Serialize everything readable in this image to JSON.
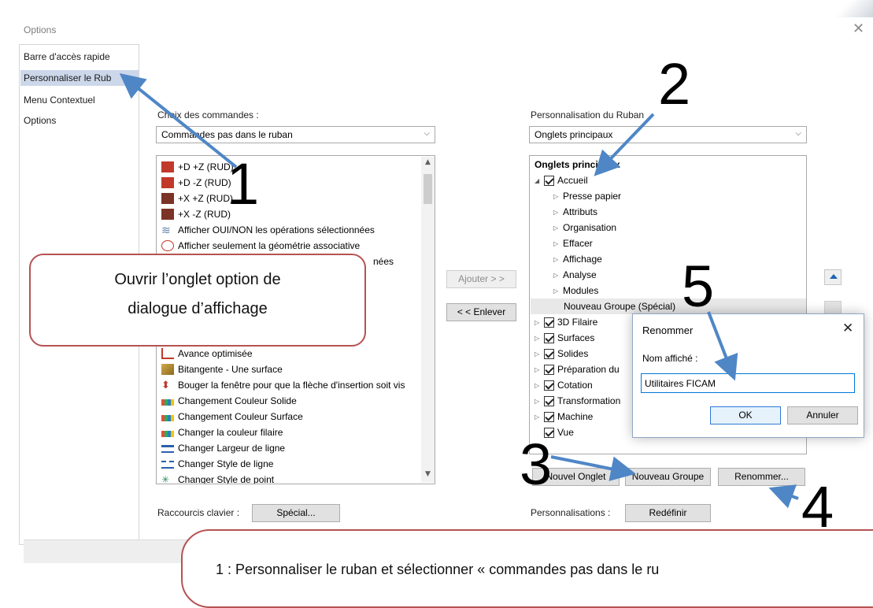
{
  "window": {
    "title": "Options",
    "close_glyph": "✕"
  },
  "nav": {
    "items": [
      "Barre d'accès rapide",
      "Personnaliser le Rub",
      "Menu Contextuel",
      "Options"
    ]
  },
  "left": {
    "label": "Choix des commandes :",
    "combo_value": "Commandes pas dans le ruban",
    "commands": [
      "+D +Z (RUD)",
      "+D -Z (RUD)",
      "+X +Z (RUD)",
      "+X -Z (RUD)",
      "Afficher OUI/NON les opérations sélectionnées",
      "Afficher seulement la géométrie associative",
      "nées",
      "Avance optimisée",
      "Bitangente - Une surface",
      "Bouger la fenêtre pour que la flèche d'insertion soit vis",
      "Changement Couleur Solide",
      "Changement Couleur Surface",
      "Changer la couleur filaire",
      "Changer Largeur de ligne",
      "Changer Style de ligne",
      "Changer Style de point"
    ],
    "shortcuts_label": "Raccourcis clavier :",
    "special_button": "Spécial..."
  },
  "middle": {
    "add_button": "Ajouter > >",
    "remove_button": "< < Enlever"
  },
  "right": {
    "label": "Personnalisation du Ruban",
    "combo_value": "Onglets principaux",
    "tree_header": "Onglets principaux",
    "tree_top": "Accueil",
    "tree_children": [
      "Presse papier",
      "Attributs",
      "Organisation",
      "Effacer",
      "Affichage",
      "Analyse",
      "Modules"
    ],
    "new_group_special": "Nouveau Groupe (Spécial)",
    "tabs": [
      "3D Filaire",
      "Surfaces",
      "Solides",
      "Préparation du",
      "Cotation",
      "Transformation",
      "Machine",
      "Vue"
    ],
    "new_tab_button": "Nouvel Onglet",
    "new_group_button": "Nouveau Groupe",
    "rename_button": "Renommer...",
    "customizations_label": "Personnalisations :",
    "reset_button": "Redéfinir"
  },
  "rename_dialog": {
    "title": "Renommer",
    "close_glyph": "✕",
    "label": "Nom affiché :",
    "value": "Utilitaires FICAM",
    "ok": "OK",
    "cancel": "Annuler"
  },
  "annotations": {
    "callout_left_line1": "Ouvrir l’onglet option de",
    "callout_left_line2": "dialogue d’affichage",
    "callout_bottom": "1 : Personnaliser le ruban et sélectionner « commandes pas dans le ru",
    "n1": "1",
    "n2": "2",
    "n3": "3",
    "n4": "4",
    "n5": "5"
  },
  "colors": {
    "arrow": "#4f86c6",
    "callout_border": "#b65253",
    "selection": "#ccd7ea"
  }
}
